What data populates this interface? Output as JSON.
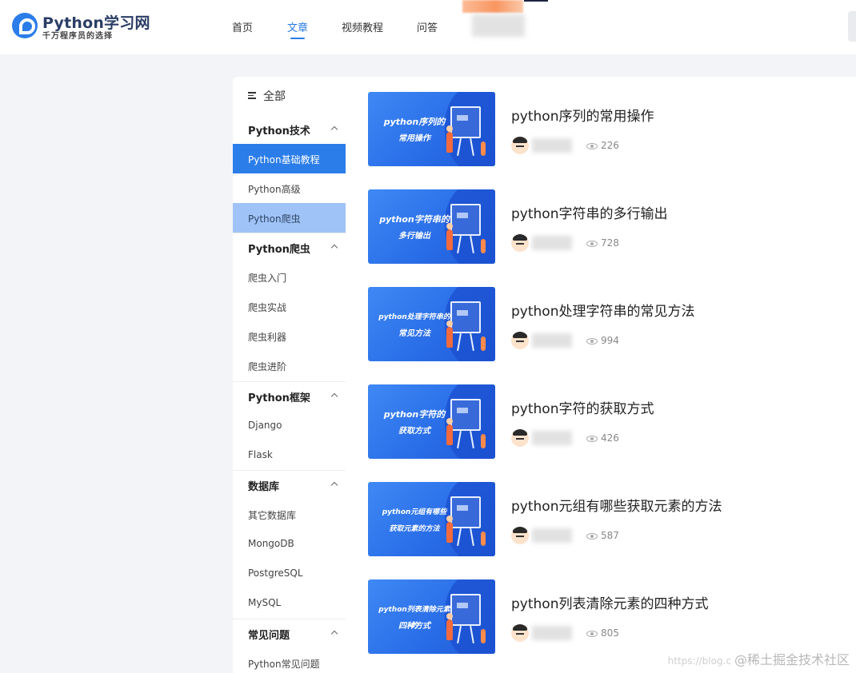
{
  "header": {
    "logo_title": "Python学习网",
    "logo_subtitle": "千万程序员的选择",
    "nav": [
      {
        "label": "首页",
        "active": false
      },
      {
        "label": "文章",
        "active": true
      },
      {
        "label": "视频教程",
        "active": false
      },
      {
        "label": "问答",
        "active": false
      }
    ]
  },
  "sidebar": {
    "all_label": "全部",
    "groups": [
      {
        "title": "Python技术",
        "items": [
          {
            "label": "Python基础教程",
            "state": "active"
          },
          {
            "label": "Python高级",
            "state": "normal"
          },
          {
            "label": "Python爬虫",
            "state": "hover"
          }
        ]
      },
      {
        "title": "Python爬虫",
        "items": [
          {
            "label": "爬虫入门",
            "state": "normal"
          },
          {
            "label": "爬虫实战",
            "state": "normal"
          },
          {
            "label": "爬虫利器",
            "state": "normal"
          },
          {
            "label": "爬虫进阶",
            "state": "normal"
          }
        ]
      },
      {
        "title": "Python框架",
        "items": [
          {
            "label": "Django",
            "state": "normal"
          },
          {
            "label": "Flask",
            "state": "normal"
          }
        ]
      },
      {
        "title": "数据库",
        "items": [
          {
            "label": "其它数据库",
            "state": "normal"
          },
          {
            "label": "MongoDB",
            "state": "normal"
          },
          {
            "label": "PostgreSQL",
            "state": "normal"
          },
          {
            "label": "MySQL",
            "state": "normal"
          }
        ]
      },
      {
        "title": "常见问题",
        "items": [
          {
            "label": "Python常见问题",
            "state": "normal"
          }
        ]
      }
    ]
  },
  "articles": [
    {
      "title": "python序列的常用操作",
      "thumb_line1": "python序列的",
      "thumb_line2": "常用操作",
      "views": "226"
    },
    {
      "title": "python字符串的多行输出",
      "thumb_line1": "python字符串的",
      "thumb_line2": "多行输出",
      "views": "728"
    },
    {
      "title": "python处理字符串的常见方法",
      "thumb_line1": "python处理字符串的",
      "thumb_line2": "常见方法",
      "views": "994"
    },
    {
      "title": "python字符的获取方式",
      "thumb_line1": "python字符的",
      "thumb_line2": "获取方式",
      "views": "426"
    },
    {
      "title": "python元组有哪些获取元素的方法",
      "thumb_line1": "python元组有哪些",
      "thumb_line2": "获取元素的方法",
      "views": "587"
    },
    {
      "title": "python列表清除元素的四种方式",
      "thumb_line1": "python列表清除元素的",
      "thumb_line2": "四种方式",
      "views": "805"
    }
  ],
  "watermark": {
    "url": "https://blog.c",
    "brand": "@稀土掘金技术社区"
  },
  "colors": {
    "accent": "#2b7de9",
    "sidebar_hover": "#9fc3f6",
    "page_bg": "#f2f4f7"
  }
}
